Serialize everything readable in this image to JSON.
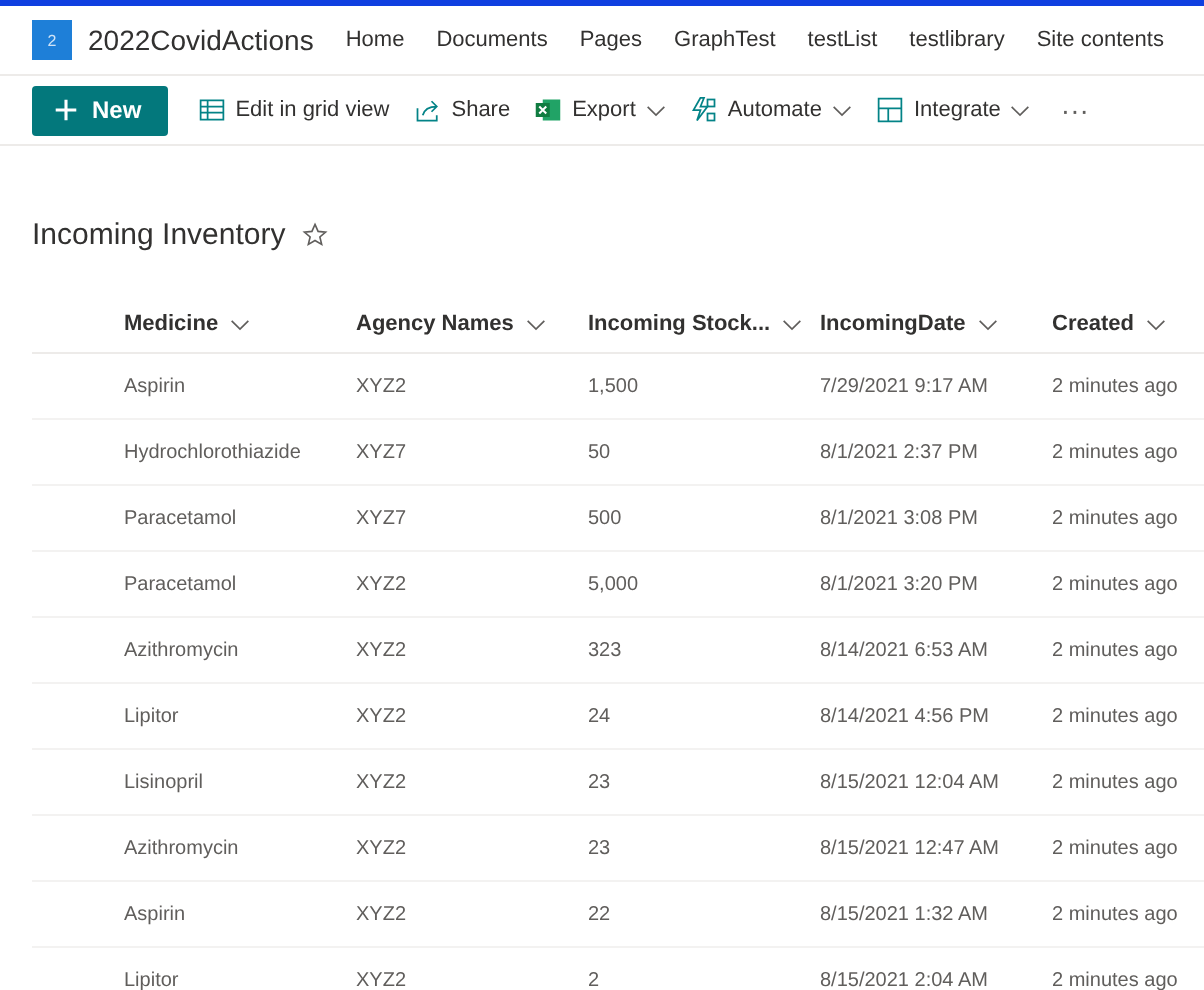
{
  "site": {
    "logo": "2",
    "title": "2022CovidActions",
    "nav": [
      "Home",
      "Documents",
      "Pages",
      "GraphTest",
      "testList",
      "testlibrary",
      "Site contents"
    ]
  },
  "toolbar": {
    "new_button": "New",
    "items": [
      {
        "label": "Edit in grid view",
        "kind": "grid",
        "dropdown": false
      },
      {
        "label": "Share",
        "kind": "share",
        "dropdown": false
      },
      {
        "label": "Export",
        "kind": "excel",
        "dropdown": true
      },
      {
        "label": "Automate",
        "kind": "automate",
        "dropdown": true
      },
      {
        "label": "Integrate",
        "kind": "integrate",
        "dropdown": true
      }
    ],
    "more": "···"
  },
  "list": {
    "title": "Incoming Inventory",
    "favorite": false
  },
  "table": {
    "columns": [
      "Medicine",
      "Agency Names",
      "Incoming Stock...",
      "IncomingDate",
      "Created"
    ],
    "rows": [
      [
        "Aspirin",
        "XYZ2",
        "1,500",
        "7/29/2021 9:17 AM",
        "2 minutes ago"
      ],
      [
        "Hydrochlorothiazide",
        "XYZ7",
        "50",
        "8/1/2021 2:37 PM",
        "2 minutes ago"
      ],
      [
        "Paracetamol",
        "XYZ7",
        "500",
        "8/1/2021 3:08 PM",
        "2 minutes ago"
      ],
      [
        "Paracetamol",
        "XYZ2",
        "5,000",
        "8/1/2021 3:20 PM",
        "2 minutes ago"
      ],
      [
        "Azithromycin",
        "XYZ2",
        "323",
        "8/14/2021 6:53 AM",
        "2 minutes ago"
      ],
      [
        "Lipitor",
        "XYZ2",
        "24",
        "8/14/2021 4:56 PM",
        "2 minutes ago"
      ],
      [
        "Lisinopril",
        "XYZ2",
        "23",
        "8/15/2021 12:04 AM",
        "2 minutes ago"
      ],
      [
        "Azithromycin",
        "XYZ2",
        "23",
        "8/15/2021 12:47 AM",
        "2 minutes ago"
      ],
      [
        "Aspirin",
        "XYZ2",
        "22",
        "8/15/2021 1:32 AM",
        "2 minutes ago"
      ],
      [
        "Lipitor",
        "XYZ2",
        "2",
        "8/15/2021 2:04 AM",
        "2 minutes ago"
      ]
    ]
  }
}
